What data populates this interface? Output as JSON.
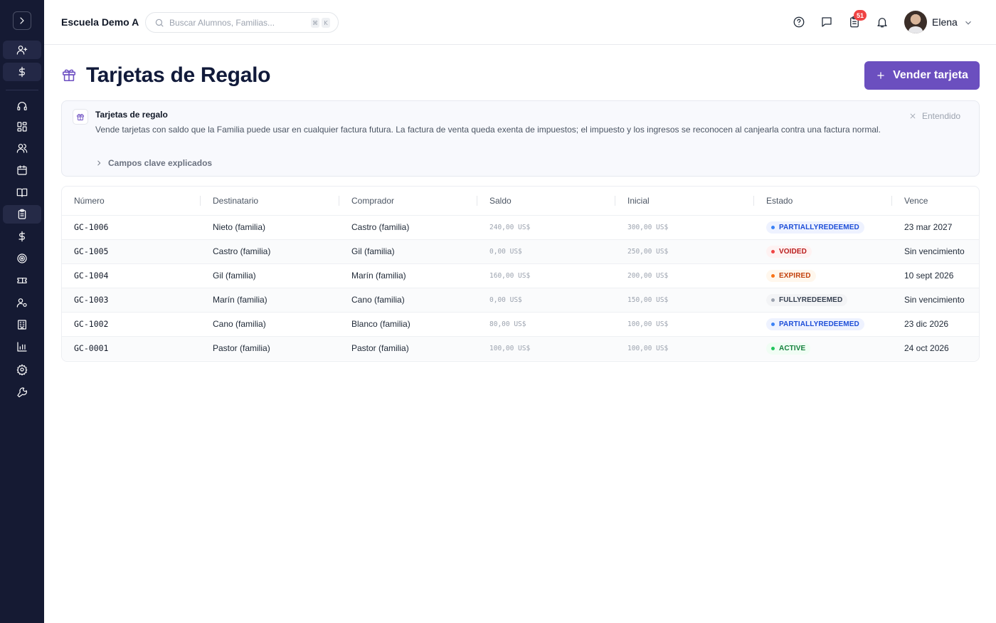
{
  "topbar": {
    "school_name": "Escuela Demo A",
    "search_placeholder": "Buscar Alumnos, Familias...",
    "shortcut_keys": [
      "⌘",
      "K"
    ],
    "notification_count": "51",
    "user_name": "Elena"
  },
  "sidebar": {
    "icons": [
      "chevron-right-icon",
      "user-plus-icon",
      "dollar-icon",
      "headset-icon",
      "dashboard-icon",
      "users-icon",
      "calendar-icon",
      "book-icon",
      "clipboard-icon",
      "dollar-icon",
      "target-icon",
      "ticket-icon",
      "user-cog-icon",
      "building-icon",
      "bar-chart-icon",
      "settings-icon",
      "wrench-icon"
    ],
    "active_item": "clipboard-icon"
  },
  "page": {
    "title": "Tarjetas de Regalo",
    "sell_button_label": "Vender tarjeta"
  },
  "info_panel": {
    "title": "Tarjetas de regalo",
    "text": "Vende tarjetas con saldo que la Familia puede usar en cualquier factura futura. La factura de venta queda exenta de impuestos; el impuesto y los ingresos se reconocen al canjearla contra una factura normal.",
    "dismiss_label": "Entendido",
    "expand_label": "Campos clave explicados"
  },
  "table": {
    "columns": [
      "Número",
      "Destinatario",
      "Comprador",
      "Saldo",
      "Inicial",
      "Estado",
      "Vence"
    ],
    "rows": [
      {
        "numero": "GC-1006",
        "destinatario": "Nieto (familia)",
        "comprador": "Castro (familia)",
        "saldo": "240,00 US$",
        "inicial": "300,00 US$",
        "estado": "PARTIALLYREDEEMED",
        "vence": "23 mar 2027"
      },
      {
        "numero": "GC-1005",
        "destinatario": "Castro (familia)",
        "comprador": "Gil (familia)",
        "saldo": "0,00 US$",
        "inicial": "250,00 US$",
        "estado": "VOIDED",
        "vence": "Sin vencimiento"
      },
      {
        "numero": "GC-1004",
        "destinatario": "Gil (familia)",
        "comprador": "Marín (familia)",
        "saldo": "160,00 US$",
        "inicial": "200,00 US$",
        "estado": "EXPIRED",
        "vence": "10 sept 2026"
      },
      {
        "numero": "GC-1003",
        "destinatario": "Marín (familia)",
        "comprador": "Cano (familia)",
        "saldo": "0,00 US$",
        "inicial": "150,00 US$",
        "estado": "FULLYREDEEMED",
        "vence": "Sin vencimiento"
      },
      {
        "numero": "GC-1002",
        "destinatario": "Cano (familia)",
        "comprador": "Blanco (familia)",
        "saldo": "80,00 US$",
        "inicial": "100,00 US$",
        "estado": "PARTIALLYREDEEMED",
        "vence": "23 dic 2026"
      },
      {
        "numero": "GC-0001",
        "destinatario": "Pastor (familia)",
        "comprador": "Pastor (familia)",
        "saldo": "100,00 US$",
        "inicial": "100,00 US$",
        "estado": "ACTIVE",
        "vence": "24 oct 2026"
      }
    ]
  },
  "status_colors": {
    "PARTIALLYREDEEMED": {
      "text": "#1d4ed8",
      "bg": "#eef2ff",
      "dot": "#3b82f6"
    },
    "VOIDED": {
      "text": "#b91c1c",
      "bg": "#fef2f2",
      "dot": "#ef4444"
    },
    "EXPIRED": {
      "text": "#c2410c",
      "bg": "#fff7ed",
      "dot": "#f97316"
    },
    "FULLYREDEEMED": {
      "text": "#374151",
      "bg": "#f3f4f6",
      "dot": "#9ca3af"
    },
    "ACTIVE": {
      "text": "#15803d",
      "bg": "#f0fdf4",
      "dot": "#22c55e"
    }
  },
  "colors": {
    "accent": "#6b4fbf",
    "sidebar_bg": "#151a33"
  }
}
